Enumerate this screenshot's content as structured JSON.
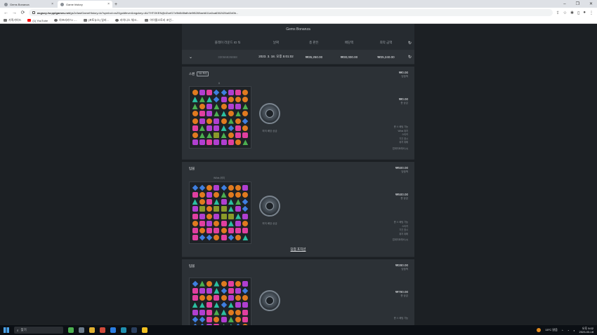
{
  "browser": {
    "tabs": [
      {
        "title": "Gems Bonanza",
        "active": false
      },
      {
        "title": "Game history",
        "active": true
      }
    ],
    "new_tab": "+",
    "window_controls": [
      "–",
      "❐",
      "✕"
    ],
    "url_host": "asgsoy-tw.pplgames.net",
    "url_rest": "/gs2c/lastGameHistory.do?symbol=vs20goldfever&mgckey=AUTHTOKEN@d2cef17e9b8b5fafb4e9f6269aeb611a0ca6362426a02d0b..."
  },
  "bookmarks": [
    {
      "icon": "apps-icon",
      "label": "가족가이드"
    },
    {
      "icon": "youtube-icon",
      "label": "(1) YouTube"
    },
    {
      "icon": "globe-icon",
      "label": "아프리카TV -..."
    },
    {
      "icon": "news-icon",
      "label": "(포토뉴스) 일러..."
    },
    {
      "icon": "globe-icon",
      "label": "라이나스 체크..."
    },
    {
      "icon": "link-icon",
      "label": "어이울스토리 조인..."
    }
  ],
  "game": {
    "title": "Gems Bonanza",
    "columns": [
      "플레이 라운드 ID ⇅",
      "날짜",
      "총 판돈",
      "배당액",
      "최악 금액"
    ],
    "summary": {
      "round_id": "33066826868",
      "date": "2023. 3. 18. 오후 5:01:02",
      "total_bet": "₩35,250.00",
      "payout": "₩30,000.00",
      "worst": "₩25,240.00"
    }
  },
  "spins": [
    {
      "type": "스핀",
      "badge": "7/8 프리",
      "amount": "₩0.00",
      "amount_label": "당첨액",
      "win_amount": "₩0.00",
      "win_label": "총 상금",
      "board_top": "8",
      "coin_label": "최저 배당 상금",
      "stats": [
        "총 스 배팅 기능",
        "Wilds 위치",
        "스티커",
        "기간 표시",
        "위치 위해"
      ],
      "footer": "업데이트에서 (x)",
      "grid": [
        [
          "orange",
          "purple",
          "pink",
          "blue",
          "blue",
          "purple",
          "pink",
          "orange"
        ],
        [
          "teal",
          "green",
          "teal",
          "blue",
          "purple",
          "orange",
          "orange",
          "orange"
        ],
        [
          "green",
          "orange",
          "purple",
          "green",
          "orange",
          "purple",
          "purple",
          "green"
        ],
        [
          "orange",
          "pink",
          "purple",
          "green",
          "teal",
          "orange",
          "green",
          "orange"
        ],
        [
          "orange",
          "purple",
          "orange",
          "purple",
          "orange",
          "green",
          "orange",
          "blue"
        ],
        [
          "pink",
          "green",
          "purple",
          "purple",
          "teal",
          "blue",
          "pink",
          "orange"
        ],
        [
          "orange",
          "green",
          "green",
          "olive",
          "green",
          "orange",
          "pink",
          "pink"
        ],
        [
          "purple",
          "purple",
          "pink",
          "purple",
          "purple",
          "pink",
          "orange",
          "green"
        ]
      ]
    },
    {
      "type": "텀블",
      "amount": "₩500.00",
      "amount_label": "당첨액",
      "win_amount": "₩500.00",
      "win_label": "총 상금",
      "board_top": "Wilds 위치",
      "coin_label": "최저 배당 상금",
      "stats": [
        "총 스 배팅 기능",
        "스티커",
        "기간 표시",
        "위치 위해"
      ],
      "footer": "업데이트에서 (x)",
      "win_position": "당첨 포지션",
      "grid": [
        [
          "blue",
          "blue",
          "orange",
          "purple",
          "blue",
          "orange",
          "orange",
          "purple"
        ],
        [
          "pink",
          "orange",
          "purple",
          "orange",
          "green",
          "orange",
          "orange",
          "orange"
        ],
        [
          "teal",
          "orange",
          "pink",
          "teal",
          "purple",
          "teal",
          "green",
          "blue"
        ],
        [
          "purple",
          "olive",
          "orange",
          "olive",
          "olive",
          "teal",
          "purple",
          "blue"
        ],
        [
          "pink",
          "purple",
          "orange",
          "purple",
          "olive",
          "olive",
          "teal",
          "purple"
        ],
        [
          "orange",
          "pink",
          "purple",
          "orange",
          "pink",
          "teal",
          "purple",
          "orange"
        ],
        [
          "pink",
          "orange",
          "pink",
          "pink",
          "orange",
          "pink",
          "pink",
          "pink"
        ],
        [
          "pink",
          "blue",
          "blue",
          "orange",
          "pink",
          "blue",
          "orange",
          "teal"
        ]
      ]
    },
    {
      "type": "텀블",
      "amount": "₩280.00",
      "amount_label": "당첨액",
      "win_amount": "₩780.00",
      "win_label": "총 상금",
      "stats": [
        "총 스 배팅 기능"
      ],
      "grid": [
        [
          "blue",
          "green",
          "orange",
          "teal",
          "orange",
          "pink",
          "orange",
          "purple"
        ],
        [
          "pink",
          "purple",
          "purple",
          "teal",
          "blue",
          "pink",
          "purple",
          "blue"
        ],
        [
          "pink",
          "orange",
          "orange",
          "pink",
          "orange",
          "purple",
          "orange",
          "orange"
        ],
        [
          "teal",
          "teal",
          "pink",
          "teal",
          "blue",
          "teal",
          "purple",
          "purple"
        ],
        [
          "purple",
          "purple",
          "pink",
          "green",
          "teal",
          "orange",
          "orange",
          "pink"
        ],
        [
          "blue",
          "blue",
          "pink",
          "orange",
          "purple",
          "green",
          "orange",
          "pink"
        ],
        [
          "blue",
          "blue",
          "purple",
          "pink",
          "green",
          "teal",
          "blue",
          "orange"
        ],
        [
          "green",
          "blue",
          "orange",
          "orange",
          "blue",
          "pink",
          "blue",
          "orange"
        ]
      ]
    }
  ],
  "taskbar": {
    "search_label": "찾기",
    "weather": "15°C 맑음",
    "time": "오후 5:02",
    "date": "2023-03-18"
  }
}
